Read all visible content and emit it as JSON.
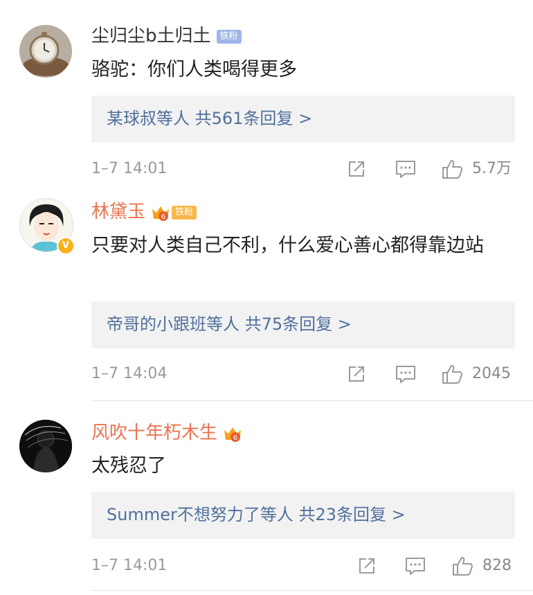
{
  "comments": [
    {
      "user": "尘归尘b土归土",
      "fan_badge": "铁粉",
      "text": "骆驼：你们人类喝得更多",
      "reply_summary": "某球叔等人  共561条回复 >",
      "time": "1–7 14:01",
      "likes": "5.7万"
    },
    {
      "user": "林黛玉",
      "vip_level": "6",
      "fan_badge": "铁粉",
      "verified": "V",
      "text": "只要对人类自己不利，什么爱心善心都得靠边站",
      "reply_summary": "帝哥的小跟班等人  共75条回复 >",
      "time": "1–7 14:04",
      "likes": "2045"
    },
    {
      "user": "风吹十年朽木生",
      "vip_level": "6",
      "text": "太残忍了",
      "reply_summary": "Summer不想努力了等人  共23条回复 >",
      "time": "1–7 14:01",
      "likes": "828"
    }
  ],
  "icons": {
    "share": "share-icon",
    "comment": "comment-icon",
    "like": "thumbs-up-icon",
    "crown": "vip-crown-icon"
  },
  "colors": {
    "vip_name": "#eb7350",
    "reply_link": "#50709c",
    "reply_bg": "#f2f2f2",
    "meta_gray": "#999999",
    "fan_badge_blue": "#9cb6e8",
    "fan_badge_gold": "#f6b74a",
    "verified_badge": "#f6b21b"
  }
}
